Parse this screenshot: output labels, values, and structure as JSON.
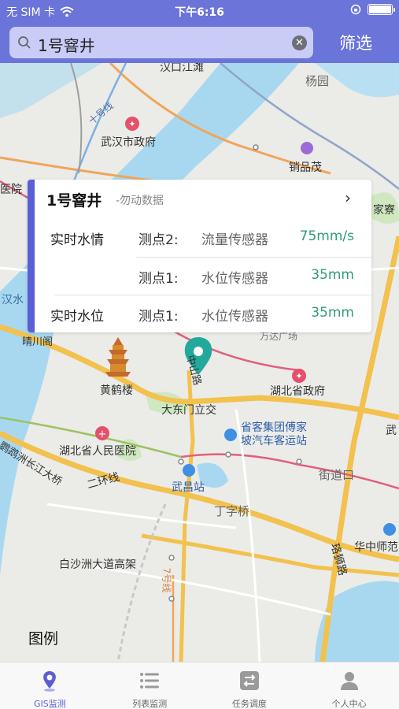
{
  "status_bar": {
    "carrier": "无 SIM 卡",
    "time": "下午6:16"
  },
  "search": {
    "query": "1号窨井"
  },
  "header": {
    "filter_label": "筛选"
  },
  "map": {
    "labels": {
      "hankou_jiangtan": "汉口江滩",
      "yangyuan": "杨园",
      "shiyihaoxian": "十号线",
      "wuhan_gov": "武汉市政府",
      "xiaojiamao": "销品茂",
      "hospital_left": "医院",
      "jiamu": "家寮",
      "hanshui": "汉水",
      "qingchuan": "晴川阁",
      "wanda": "万达广场",
      "yellow_crane": "黄鹤楼",
      "zhongshan_road": "中山路",
      "hubei_gov": "湖北省政府",
      "dadongmen": "大东门立交",
      "provincial_bus": "省客集团傅家坡汽车客运站",
      "hubei_hospital": "湖北省人民医院",
      "yangtze_bridge": "鹦鹉洲长江大桥",
      "erhuanxian": "二环线",
      "wuchang_station": "武昌站",
      "jiedaokou": "街道口",
      "dingziqiao": "丁字桥",
      "luoshi_road": "珞狮路",
      "central_china_normal": "华中师范",
      "baishazhou": "白沙洲大道高架",
      "line7": "7号线",
      "wu_right": "武"
    },
    "legend_label": "图例"
  },
  "info_card": {
    "title": "1号窨井",
    "subtitle": "-勿动数据",
    "chevron": "›",
    "rows": [
      {
        "label": "实时水情",
        "point": "测点2:",
        "sensor": "流量传感器",
        "value": "75mm/s"
      },
      {
        "label": "",
        "point": "测点1:",
        "sensor": "水位传感器",
        "value": "35mm"
      },
      {
        "label": "实时水位",
        "point": "测点1:",
        "sensor": "水位传感器",
        "value": "35mm"
      }
    ]
  },
  "tabs": [
    {
      "label": "GIS监测",
      "icon": "location-pin-icon",
      "active": true
    },
    {
      "label": "列表监测",
      "icon": "list-icon",
      "active": false
    },
    {
      "label": "任务调度",
      "icon": "task-swap-icon",
      "active": false
    },
    {
      "label": "个人中心",
      "icon": "person-icon",
      "active": false
    }
  ],
  "colors": {
    "header": "#6a74d9",
    "accent": "#5b5fd4",
    "value_green": "#2e9d7b",
    "marker_teal": "#23a99a",
    "water": "#a8d8f0"
  }
}
